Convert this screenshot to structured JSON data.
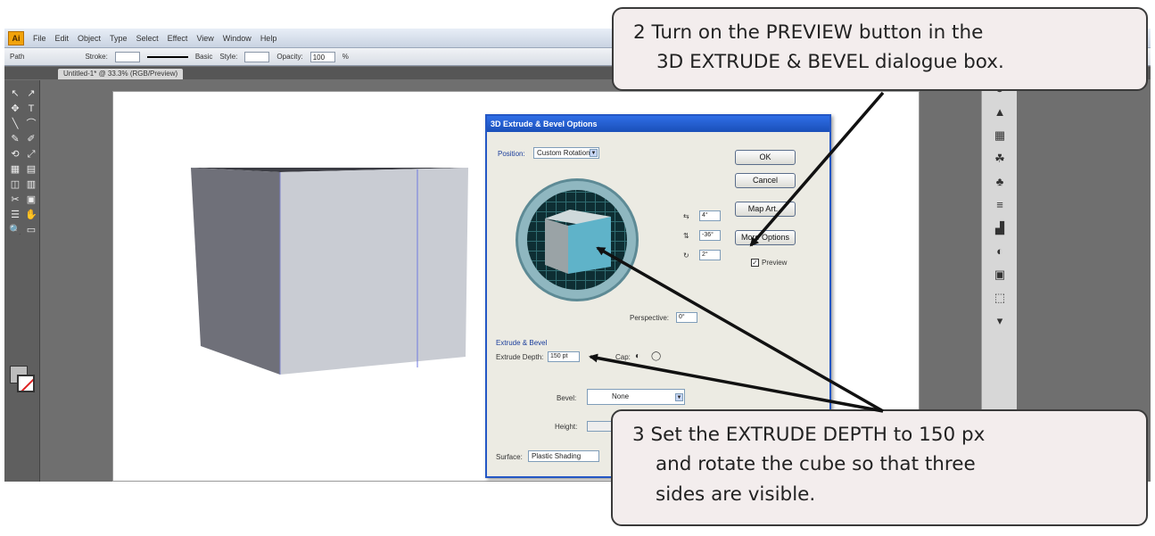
{
  "app": {
    "logo": "Ai",
    "menus": [
      "File",
      "Edit",
      "Object",
      "Type",
      "Select",
      "Effect",
      "View",
      "Window",
      "Help"
    ],
    "control_bar": {
      "object_label": "Path",
      "stroke_label": "Stroke:",
      "stroke_value": "",
      "style_label": "Style:",
      "basic_label": "Basic",
      "opacity_label": "Opacity:",
      "opacity_value": "100",
      "percent": "%"
    },
    "doc_tab": "Untitled-1* @ 33.3% (RGB/Preview)"
  },
  "tools": [
    "↖",
    "↗",
    "✥",
    "T",
    "╲",
    "⌒",
    "✎",
    "✐",
    "⟲",
    "⤢",
    "▦",
    "▤",
    "◫",
    "▥",
    "✂",
    "▣",
    "☰",
    "✋",
    "🔍",
    "▭"
  ],
  "dock_icons": [
    "↺",
    "▲",
    "▦",
    "☘",
    "♣",
    "≡",
    "▟",
    "◐",
    "▣",
    "⬚",
    "▾"
  ],
  "dialog": {
    "title": "3D Extrude & Bevel Options",
    "position_label": "Position:",
    "position_value": "Custom Rotation",
    "angle_x": "4°",
    "angle_y": "-36°",
    "angle_z": "2°",
    "perspective_label": "Perspective:",
    "perspective_value": "0°",
    "extrude_section": "Extrude & Bevel",
    "extrude_depth_label": "Extrude Depth:",
    "extrude_depth_value": "150 pt",
    "cap_label": "Cap:",
    "bevel_label": "Bevel:",
    "bevel_value": "None",
    "height_label": "Height:",
    "surface_label": "Surface:",
    "surface_value": "Plastic Shading",
    "buttons": {
      "ok": "OK",
      "cancel": "Cancel",
      "map_art": "Map Art...",
      "more_options": "More Options"
    },
    "preview_label": "Preview",
    "preview_checked": true
  },
  "callouts": {
    "step2": [
      "2 Turn on the PREVIEW button in the",
      "3D EXTRUDE & BEVEL dialogue box."
    ],
    "step3": [
      "3 Set the EXTRUDE DEPTH to 150 px",
      "and rotate the cube so that three",
      "sides are visible."
    ]
  },
  "colors": {
    "dialog_title": "#1a4fb8",
    "cube_front": "#cfd4dd",
    "cube_left": "#74767e",
    "trackball_face": "#5fb3c9"
  }
}
